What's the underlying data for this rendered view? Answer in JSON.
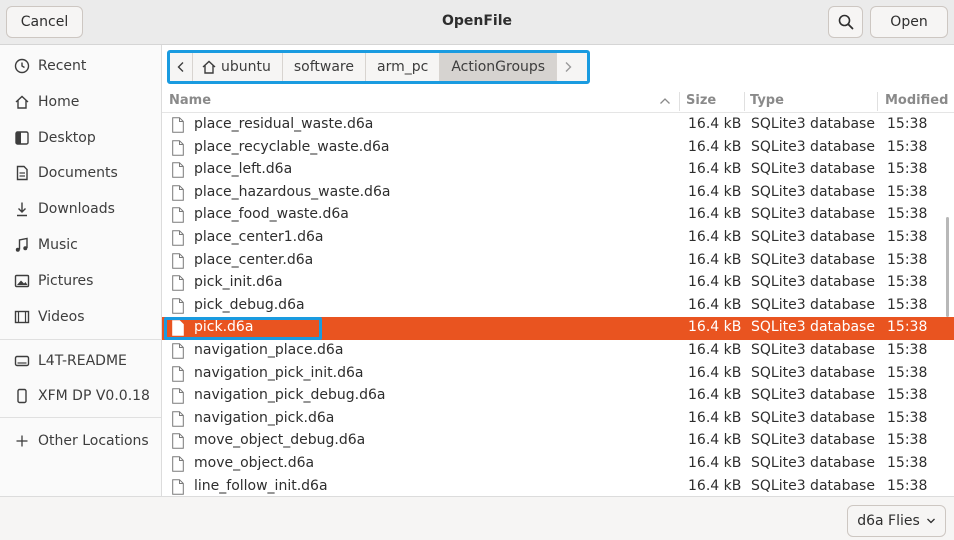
{
  "header": {
    "cancel_label": "Cancel",
    "title": "OpenFile",
    "search_icon": "search-icon",
    "open_label": "Open"
  },
  "sidebar": {
    "items": [
      {
        "label": "Recent",
        "icon": "clock-icon"
      },
      {
        "label": "Home",
        "icon": "home-icon"
      },
      {
        "label": "Desktop",
        "icon": "desktop-icon"
      },
      {
        "label": "Documents",
        "icon": "document-icon"
      },
      {
        "label": "Downloads",
        "icon": "download-icon"
      },
      {
        "label": "Music",
        "icon": "music-icon"
      },
      {
        "label": "Pictures",
        "icon": "picture-icon"
      },
      {
        "label": "Videos",
        "icon": "video-icon"
      },
      {
        "label": "L4T-README",
        "icon": "drive-icon"
      },
      {
        "label": "XFM DP V0.0.18",
        "icon": "phone-icon"
      },
      {
        "label": "Other Locations",
        "icon": "plus-icon"
      }
    ]
  },
  "pathbar": {
    "crumbs": [
      "ubuntu",
      "software",
      "arm_pc",
      "ActionGroups"
    ],
    "active_crumb": "ActionGroups"
  },
  "columns": {
    "name": "Name",
    "size": "Size",
    "type": "Type",
    "modified": "Modified"
  },
  "files": [
    {
      "name": "place_residual_waste.d6a",
      "size": "16.4 kB",
      "type": "SQLite3 database",
      "modified": "15:38"
    },
    {
      "name": "place_recyclable_waste.d6a",
      "size": "16.4 kB",
      "type": "SQLite3 database",
      "modified": "15:38"
    },
    {
      "name": "place_left.d6a",
      "size": "16.4 kB",
      "type": "SQLite3 database",
      "modified": "15:38"
    },
    {
      "name": "place_hazardous_waste.d6a",
      "size": "16.4 kB",
      "type": "SQLite3 database",
      "modified": "15:38"
    },
    {
      "name": "place_food_waste.d6a",
      "size": "16.4 kB",
      "type": "SQLite3 database",
      "modified": "15:38"
    },
    {
      "name": "place_center1.d6a",
      "size": "16.4 kB",
      "type": "SQLite3 database",
      "modified": "15:38"
    },
    {
      "name": "place_center.d6a",
      "size": "16.4 kB",
      "type": "SQLite3 database",
      "modified": "15:38"
    },
    {
      "name": "pick_init.d6a",
      "size": "16.4 kB",
      "type": "SQLite3 database",
      "modified": "15:38"
    },
    {
      "name": "pick_debug.d6a",
      "size": "16.4 kB",
      "type": "SQLite3 database",
      "modified": "15:38"
    },
    {
      "name": "pick.d6a",
      "size": "16.4 kB",
      "type": "SQLite3 database",
      "modified": "15:38"
    },
    {
      "name": "navigation_place.d6a",
      "size": "16.4 kB",
      "type": "SQLite3 database",
      "modified": "15:38"
    },
    {
      "name": "navigation_pick_init.d6a",
      "size": "16.4 kB",
      "type": "SQLite3 database",
      "modified": "15:38"
    },
    {
      "name": "navigation_pick_debug.d6a",
      "size": "16.4 kB",
      "type": "SQLite3 database",
      "modified": "15:38"
    },
    {
      "name": "navigation_pick.d6a",
      "size": "16.4 kB",
      "type": "SQLite3 database",
      "modified": "15:38"
    },
    {
      "name": "move_object_debug.d6a",
      "size": "16.4 kB",
      "type": "SQLite3 database",
      "modified": "15:38"
    },
    {
      "name": "move_object.d6a",
      "size": "16.4 kB",
      "type": "SQLite3 database",
      "modified": "15:38"
    },
    {
      "name": "line_follow_init.d6a",
      "size": "16.4 kB",
      "type": "SQLite3 database",
      "modified": "15:38"
    }
  ],
  "selected_file": "pick.d6a",
  "filter": {
    "label": "d6a Flies"
  },
  "colors": {
    "selection": "#e95420",
    "highlight_box": "#1a9be0"
  }
}
